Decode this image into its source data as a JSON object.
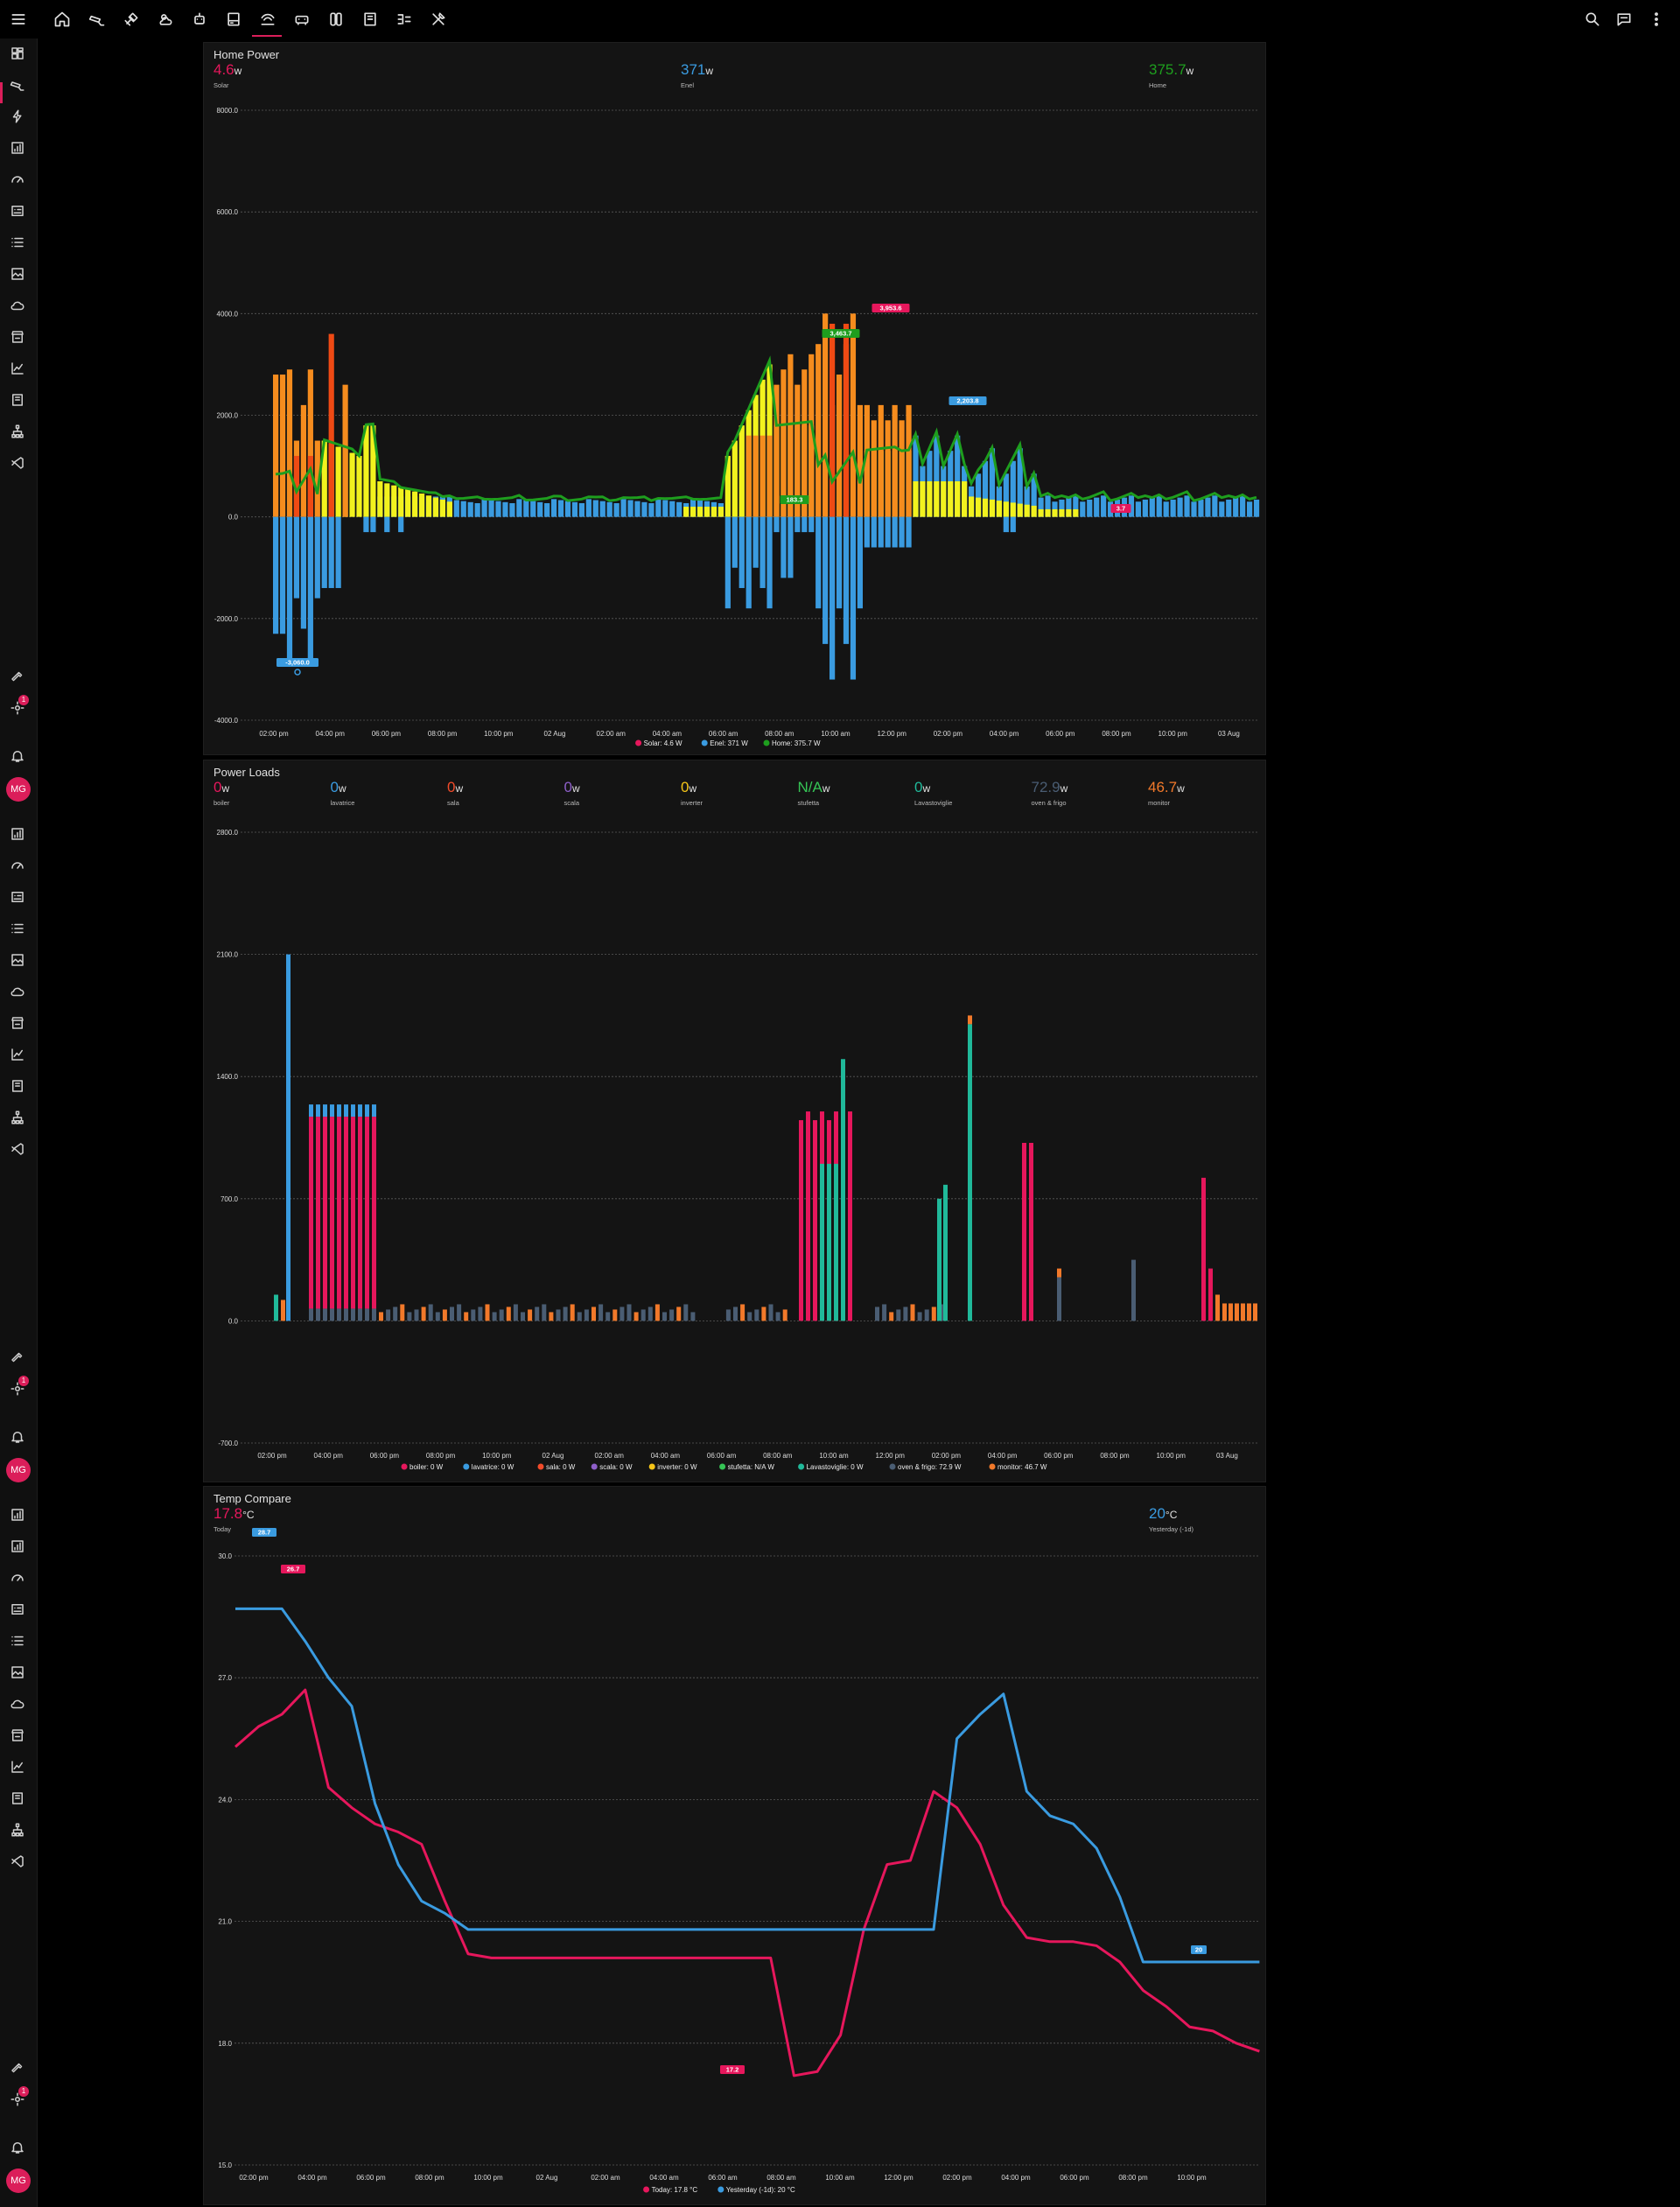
{
  "topbar": {
    "icons": [
      "menu-icon",
      "home-icon",
      "cctv-icon",
      "satellite-icon",
      "weather-icon",
      "robot-icon",
      "server-icon",
      "energy-icon",
      "car-icon",
      "switch-icon",
      "book-icon",
      "tree-icon",
      "tools-icon"
    ],
    "right_icons": [
      "search-icon",
      "assist-icon",
      "more-vert-icon"
    ]
  },
  "sidebar": {
    "badge": "1",
    "avatar": "MG"
  },
  "home_power": {
    "title": "Home Power",
    "stats": [
      {
        "value": "4.6",
        "unit": "w",
        "name": "Solar",
        "color": "#e6175c"
      },
      {
        "value": "371",
        "unit": "w",
        "name": "Enel",
        "color": "#3a9be0"
      },
      {
        "value": "375.7",
        "unit": "w",
        "name": "Home",
        "color": "#1e9e1e"
      }
    ],
    "legend": [
      {
        "label": "Solar: 4.6 W",
        "color": "#e6175c"
      },
      {
        "label": "Enel: 371 W",
        "color": "#3a9be0"
      },
      {
        "label": "Home: 375.7 W",
        "color": "#1e9e1e"
      }
    ]
  },
  "power_loads": {
    "title": "Power Loads",
    "stats": [
      {
        "value": "0",
        "unit": "w",
        "name": "boiler",
        "color": "#e6175c"
      },
      {
        "value": "0",
        "unit": "w",
        "name": "lavatrice",
        "color": "#3a9be0"
      },
      {
        "value": "0",
        "unit": "w",
        "name": "sala",
        "color": "#f24b2a"
      },
      {
        "value": "0",
        "unit": "w",
        "name": "scala",
        "color": "#8e5fc9"
      },
      {
        "value": "0",
        "unit": "w",
        "name": "inverter",
        "color": "#f5c518"
      },
      {
        "value": "N/A",
        "unit": "w",
        "name": "stufetta",
        "color": "#35c455"
      },
      {
        "value": "0",
        "unit": "w",
        "name": "Lavastoviglie",
        "color": "#20b99a"
      },
      {
        "value": "72.9",
        "unit": "w",
        "name": "oven & frigo",
        "color": "#4a5d73"
      },
      {
        "value": "46.7",
        "unit": "w",
        "name": "monitor",
        "color": "#f2792a"
      }
    ],
    "legend": [
      {
        "label": "boiler: 0 W",
        "color": "#e6175c"
      },
      {
        "label": "lavatrice: 0 W",
        "color": "#3a9be0"
      },
      {
        "label": "sala: 0 W",
        "color": "#f24b2a"
      },
      {
        "label": "scala: 0 W",
        "color": "#8e5fc9"
      },
      {
        "label": "inverter: 0 W",
        "color": "#f5c518"
      },
      {
        "label": "stufetta: N/A W",
        "color": "#35c455"
      },
      {
        "label": "Lavastoviglie: 0 W",
        "color": "#20b99a"
      },
      {
        "label": "oven & frigo: 72.9 W",
        "color": "#4a5d73"
      },
      {
        "label": "monitor: 46.7 W",
        "color": "#f2792a"
      }
    ]
  },
  "temp_compare": {
    "title": "Temp Compare",
    "stats": [
      {
        "value": "17.8",
        "unit": "°C",
        "name": "Today",
        "color": "#e6175c"
      },
      {
        "value": "20",
        "unit": "°C",
        "name": "Yesterday (-1d)",
        "color": "#3a9be0"
      }
    ],
    "legend": [
      {
        "label": "Today: 17.8 °C",
        "color": "#e6175c"
      },
      {
        "label": "Yesterday (-1d): 20 °C",
        "color": "#3a9be0"
      }
    ]
  },
  "chart_data": [
    {
      "type": "bar",
      "title": "Home Power",
      "ylim": [
        -4000,
        8000
      ],
      "yticks": [
        "8000.0",
        "6000.0",
        "4000.0",
        "2000.0",
        "0.0",
        "-2000.0",
        "-4000.0"
      ],
      "xticks": [
        "02:00 pm",
        "04:00 pm",
        "06:00 pm",
        "08:00 pm",
        "10:00 pm",
        "02 Aug",
        "02:00 am",
        "04:00 am",
        "06:00 am",
        "08:00 am",
        "10:00 am",
        "12:00 pm",
        "02:00 pm",
        "04:00 pm",
        "06:00 pm",
        "08:00 pm",
        "10:00 pm",
        "03 Aug"
      ],
      "annotations": [
        "3,953.6",
        "3,463.7",
        "2,203.8",
        "183.3",
        "-3,060.0",
        "3.7"
      ],
      "series": [
        {
          "name": "Solar",
          "color": "#e6175c"
        },
        {
          "name": "Enel",
          "color": "#3a9be0"
        },
        {
          "name": "Home",
          "color": "#1e9e1e"
        }
      ]
    },
    {
      "type": "bar",
      "title": "Power Loads",
      "ylim": [
        -700,
        2800
      ],
      "yticks": [
        "2800.0",
        "2100.0",
        "1400.0",
        "700.0",
        "0.0",
        "-700.0"
      ],
      "xticks": [
        "02:00 pm",
        "04:00 pm",
        "06:00 pm",
        "08:00 pm",
        "10:00 pm",
        "02 Aug",
        "02:00 am",
        "04:00 am",
        "06:00 am",
        "08:00 am",
        "10:00 am",
        "12:00 pm",
        "02:00 pm",
        "04:00 pm",
        "06:00 pm",
        "08:00 pm",
        "10:00 pm",
        "03 Aug"
      ]
    },
    {
      "type": "line",
      "title": "Temp Compare",
      "ylim": [
        15,
        30
      ],
      "yticks": [
        "30.0",
        "27.0",
        "24.0",
        "21.0",
        "18.0",
        "15.0"
      ],
      "xticks": [
        "02:00 pm",
        "04:00 pm",
        "06:00 pm",
        "08:00 pm",
        "10:00 pm",
        "02 Aug",
        "02:00 am",
        "04:00 am",
        "06:00 am",
        "08:00 am",
        "10:00 am",
        "12:00 pm",
        "02:00 pm",
        "04:00 pm",
        "06:00 pm",
        "08:00 pm",
        "10:00 pm"
      ],
      "annotations": [
        "28.7",
        "26.7",
        "17.2",
        "20"
      ],
      "series": [
        {
          "name": "Today",
          "color": "#e6175c",
          "values": [
            25.3,
            25.8,
            26.1,
            26.7,
            24.3,
            23.8,
            23.4,
            23.2,
            22.9,
            21.5,
            20.2,
            20.1,
            20.1,
            20.1,
            20.1,
            20.1,
            20.1,
            20.1,
            20.1,
            20.1,
            20.1,
            20.1,
            20.1,
            20.1,
            17.2,
            17.3,
            18.2,
            20.8,
            22.4,
            22.5,
            24.2,
            23.8,
            22.9,
            21.4,
            20.6,
            20.5,
            20.5,
            20.4,
            20.0,
            19.3,
            18.9,
            18.4,
            18.3,
            18.0,
            17.8
          ]
        },
        {
          "name": "Yesterday (-1d)",
          "color": "#3a9be0",
          "values": [
            28.7,
            28.7,
            28.7,
            27.9,
            27.0,
            26.3,
            23.9,
            22.4,
            21.5,
            21.2,
            20.8,
            20.8,
            20.8,
            20.8,
            20.8,
            20.8,
            20.8,
            20.8,
            20.8,
            20.8,
            20.8,
            20.8,
            20.8,
            20.8,
            20.8,
            20.8,
            20.8,
            20.8,
            20.8,
            20.8,
            20.8,
            25.5,
            26.1,
            26.6,
            24.2,
            23.6,
            23.4,
            22.8,
            21.6,
            20.0,
            20.0,
            20.0,
            20.0,
            20.0,
            20.0
          ]
        }
      ]
    }
  ]
}
